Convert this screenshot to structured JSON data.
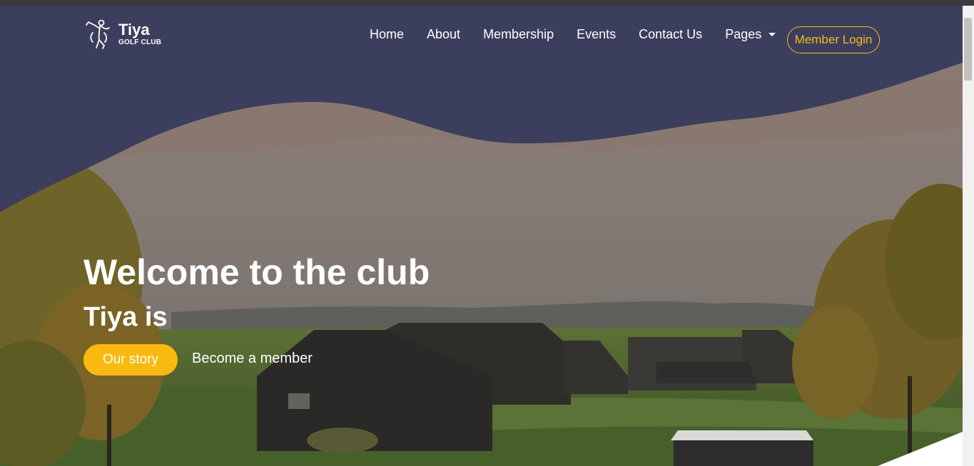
{
  "brand": {
    "name": "Tiya",
    "subtitle": "GOLF CLUB",
    "logo_icon": "golfer-icon"
  },
  "nav": {
    "links": [
      {
        "label": "Home"
      },
      {
        "label": "About"
      },
      {
        "label": "Membership"
      },
      {
        "label": "Events"
      },
      {
        "label": "Contact Us"
      },
      {
        "label": "Pages",
        "dropdown": true
      }
    ],
    "login_label": "Member Login"
  },
  "hero": {
    "title": "Welcome to the club",
    "subtitle": "Tiya is",
    "primary_button": "Our story",
    "secondary_link": "Become a member",
    "background_image": "golf-clubhouse-sunset-photo"
  },
  "colors": {
    "navy": "#3c3e5d",
    "accent": "#f9b90e",
    "outline_accent": "#f5bc1c",
    "white": "#ffffff"
  }
}
